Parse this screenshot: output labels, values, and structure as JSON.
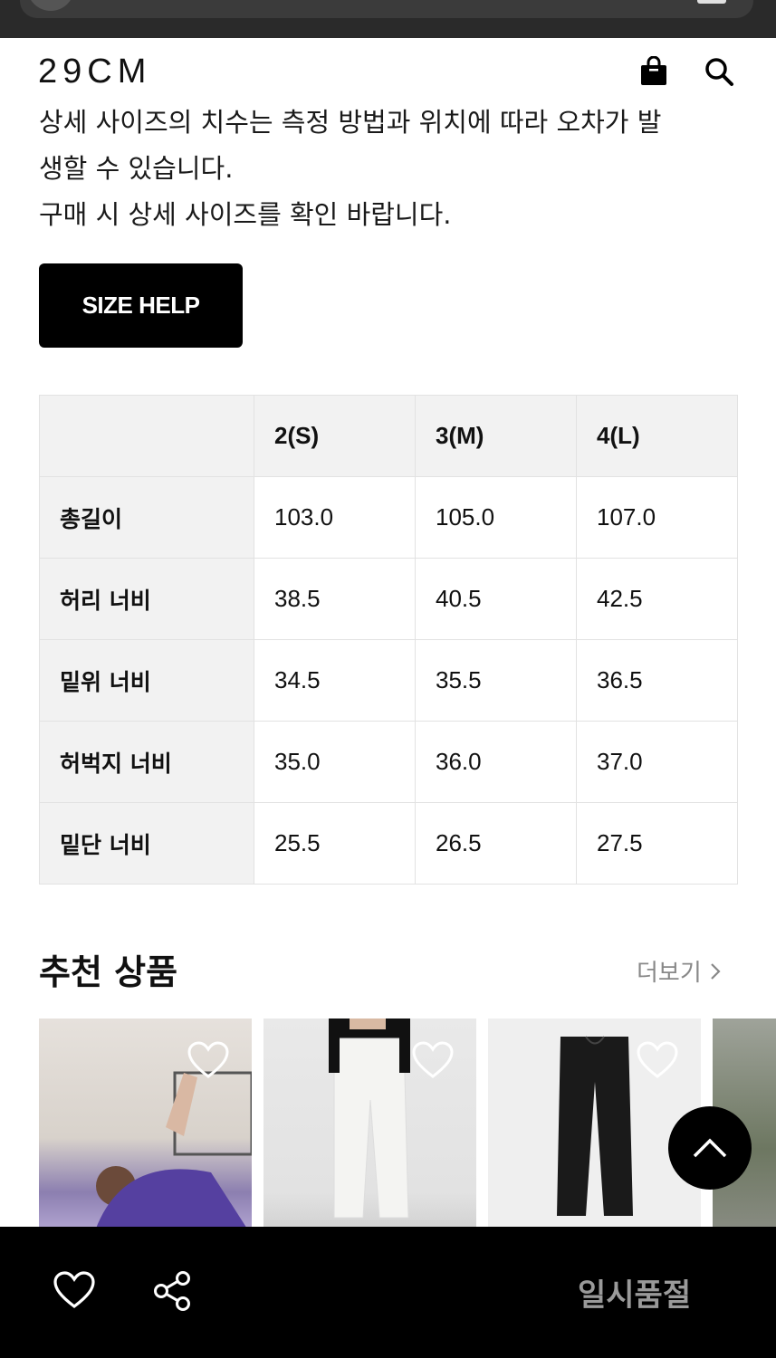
{
  "header": {
    "logo": "29CM",
    "bag_icon": "shopping-bag-icon",
    "search_icon": "search-icon"
  },
  "notice": {
    "line1": "상세 사이즈의 치수는 측정 방법과 위치에 따라 오차가 발",
    "line2": "생할 수 있습니다.",
    "line3": "구매 시 상세 사이즈를 확인 바랍니다."
  },
  "size_help": {
    "label": "SIZE HELP"
  },
  "size_table": {
    "columns": [
      "",
      "2(S)",
      "3(M)",
      "4(L)"
    ],
    "rows": [
      {
        "label": "총길이",
        "values": [
          "103.0",
          "105.0",
          "107.0"
        ]
      },
      {
        "label": "허리 너비",
        "values": [
          "38.5",
          "40.5",
          "42.5"
        ]
      },
      {
        "label": "밑위 너비",
        "values": [
          "34.5",
          "35.5",
          "36.5"
        ]
      },
      {
        "label": "허벅지 너비",
        "values": [
          "35.0",
          "36.0",
          "37.0"
        ]
      },
      {
        "label": "밑단 너비",
        "values": [
          "25.5",
          "26.5",
          "27.5"
        ]
      }
    ]
  },
  "recommend": {
    "title": "추천 상품",
    "more": "더보기"
  },
  "bottom_bar": {
    "wish_icon": "heart-icon",
    "share_icon": "share-icon",
    "status": "일시품절"
  }
}
